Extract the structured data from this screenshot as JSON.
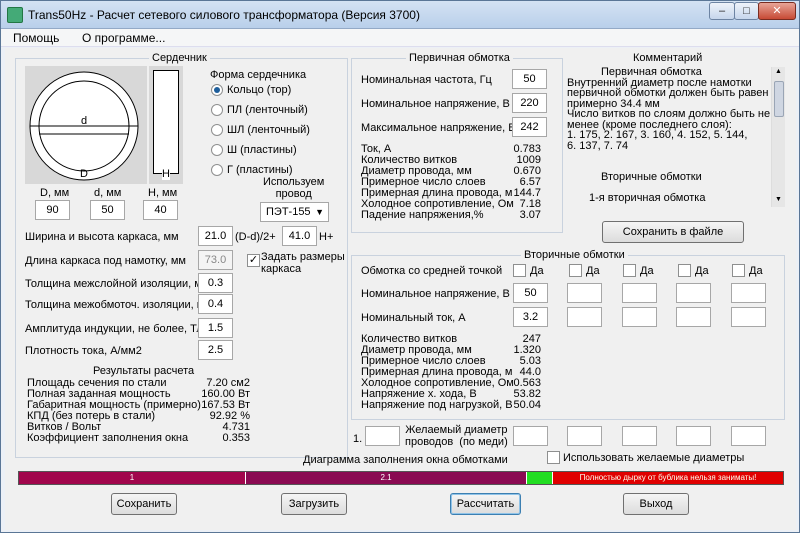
{
  "window": {
    "title": "Trans50Hz - Расчет сетевого силового трансформатора (Версия 3700)",
    "min": "–",
    "max": "□",
    "close": "✕"
  },
  "menu": {
    "help": "Помощь",
    "about": "О программе..."
  },
  "core": {
    "title": "Сердечник",
    "form_title": "Форма сердечника",
    "options": [
      "Кольцо  (тор)",
      "ПЛ  (ленточный)",
      "ШЛ  (ленточный)",
      "Ш  (пластины)",
      "Г (пластины)"
    ],
    "selected": 0,
    "d_small": "d",
    "D_big": "D",
    "H_big": "H",
    "D_label": "D, мм",
    "d_label": "d, мм",
    "H_label": "H, мм",
    "D_val": "90",
    "d_val": "50",
    "H_val": "40",
    "wire_title": "Используем\nпровод",
    "wire": "ПЭТ-155",
    "frame_label": "Ширина и высота каркаса, мм",
    "frame_w": "21.0",
    "frame_mid": "(D-d)/2+",
    "frame_h": "41.0",
    "frame_tail": "H+",
    "frame_len_label": "Длина каркаса под намотку, мм",
    "frame_len": "73.0",
    "set_frame": "Задать размеры\nкаркаса",
    "insul1_label": "Толщина межслойной изоляции, мм",
    "insul1": "0.3",
    "insul2_label": "Толщина межобмоточ. изоляции, мм",
    "insul2": "0.4",
    "induct_label": "Амплитуда индукции, не более, Тл",
    "induct": "1.5",
    "current_label": "Плотность тока, А/мм2",
    "current": "2.5"
  },
  "results": {
    "title": "Результаты расчета",
    "rows": [
      [
        "Площадь сечения по стали",
        "7.20 см2"
      ],
      [
        "Полная заданная мощность",
        "160.00 Вт"
      ],
      [
        "Габаритная мощность (примерно)",
        "167.53 Вт"
      ],
      [
        "КПД (без потерь в стали)",
        "92.92 %"
      ],
      [
        "Витков / Вольт",
        "4.731"
      ],
      [
        "Коэффициент заполнения окна",
        "0.353"
      ]
    ]
  },
  "primary": {
    "title": "Первичная обмотка",
    "freq_label": "Номинальная частота, Гц",
    "freq": "50",
    "volt_label": "Номинальное напряжение, В",
    "volt": "220",
    "vmax_label": "Максимальное напряжение, В",
    "vmax": "242",
    "rows": [
      [
        "Ток, А",
        "0.783"
      ],
      [
        "Количество витков",
        "1009"
      ],
      [
        "Диаметр провода, мм",
        "0.670"
      ],
      [
        "Примерное число слоев",
        "6.57"
      ],
      [
        "Примерная длина провода, м",
        "144.7"
      ],
      [
        "Холодное сопротивление, Ом",
        "7.18"
      ],
      [
        "Падение напряжения,%",
        "3.07"
      ]
    ]
  },
  "comment": {
    "title": "Комментарий",
    "lines": [
      "Первичная обмотка",
      "Внутренний диаметр после намотки",
      "первичной обмотки должен быть равен",
      "примерно 34.4 мм",
      "Число витков по слоям должно быть не",
      "менее (кроме последнего слоя):",
      "1. 175, 2. 167, 3. 160, 4. 152, 5. 144,",
      "6. 137, 7. 74",
      "",
      "",
      "Вторичные обмотки",
      "",
      "1-я вторичная обмотка"
    ],
    "save": "Сохранить в файле"
  },
  "secondary": {
    "title": "Вторичные обмотки",
    "mid_label": "Обмотка со средней точкой",
    "yes": "Да",
    "volt_label": "Номинальное напряжение, В",
    "volt": "50",
    "cur_label": "Номинальный ток, А",
    "cur": "3.2",
    "rows": [
      [
        "Количество витков",
        "247"
      ],
      [
        "Диаметр провода, мм",
        "1.320"
      ],
      [
        "Примерное число слоев",
        "5.03"
      ],
      [
        "Примерная длина провода, м",
        "44.0"
      ],
      [
        "Холодное сопротивление, Ом",
        "0.563"
      ],
      [
        "Напряжение х. хода, В",
        "53.82"
      ],
      [
        "Напряжение под нагрузкой, В",
        "50.04"
      ]
    ],
    "num1": "1.",
    "desired_label": "Желаемый диаметр\nпроводов  (по меди)",
    "use_desired": "Использовать желаемые диаметры"
  },
  "fill_chart": {
    "title": "Диаграмма заполнения окна обмотками",
    "seg1": "1",
    "seg2": "2.1",
    "msg": "Полностью дырку от бублика нельзя заниматы!",
    "c1": "#a1064c",
    "c2": "#8a0a52",
    "c3": "#22dd22",
    "c4": "#e00000"
  },
  "buttons": {
    "save": "Сохранить",
    "load": "Загрузить",
    "calc": "Рассчитать",
    "exit": "Выход"
  }
}
